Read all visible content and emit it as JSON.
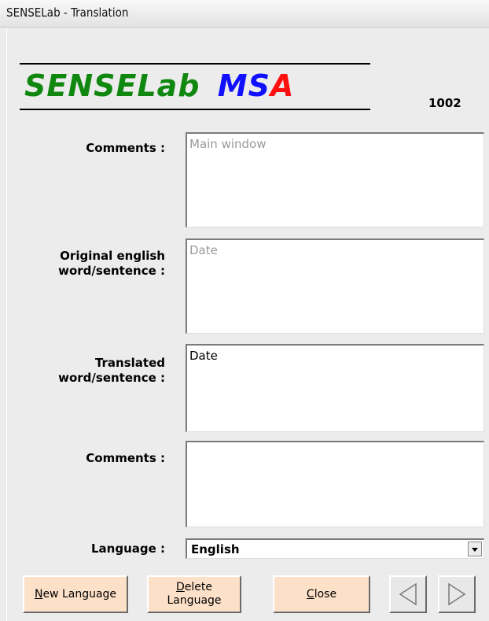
{
  "window": {
    "title": "SENSELab - Translation"
  },
  "logo": {
    "part1": "SENSELab",
    "part2": "MS",
    "part3": "A"
  },
  "record_id": "1002",
  "fields": {
    "comments1": {
      "label": "Comments :",
      "value": "Main window"
    },
    "original": {
      "label1": "Original english",
      "label2": "word/sentence :",
      "value": "Date"
    },
    "translated": {
      "label1": "Translated",
      "label2": "word/sentence :",
      "value": "Date"
    },
    "comments2": {
      "label": "Comments :",
      "value": ""
    },
    "language": {
      "label": "Language :",
      "value": "English"
    }
  },
  "buttons": {
    "new_language": {
      "prefix": "N",
      "rest": "ew Language"
    },
    "delete_language": {
      "prefix": "D",
      "rest1": "elete",
      "line2": "Language"
    },
    "close": {
      "prefix": "C",
      "rest": "lose"
    }
  },
  "icons": {
    "prev": "triangle-left-icon",
    "next": "triangle-right-icon",
    "dropdown": "chevron-down-icon"
  }
}
